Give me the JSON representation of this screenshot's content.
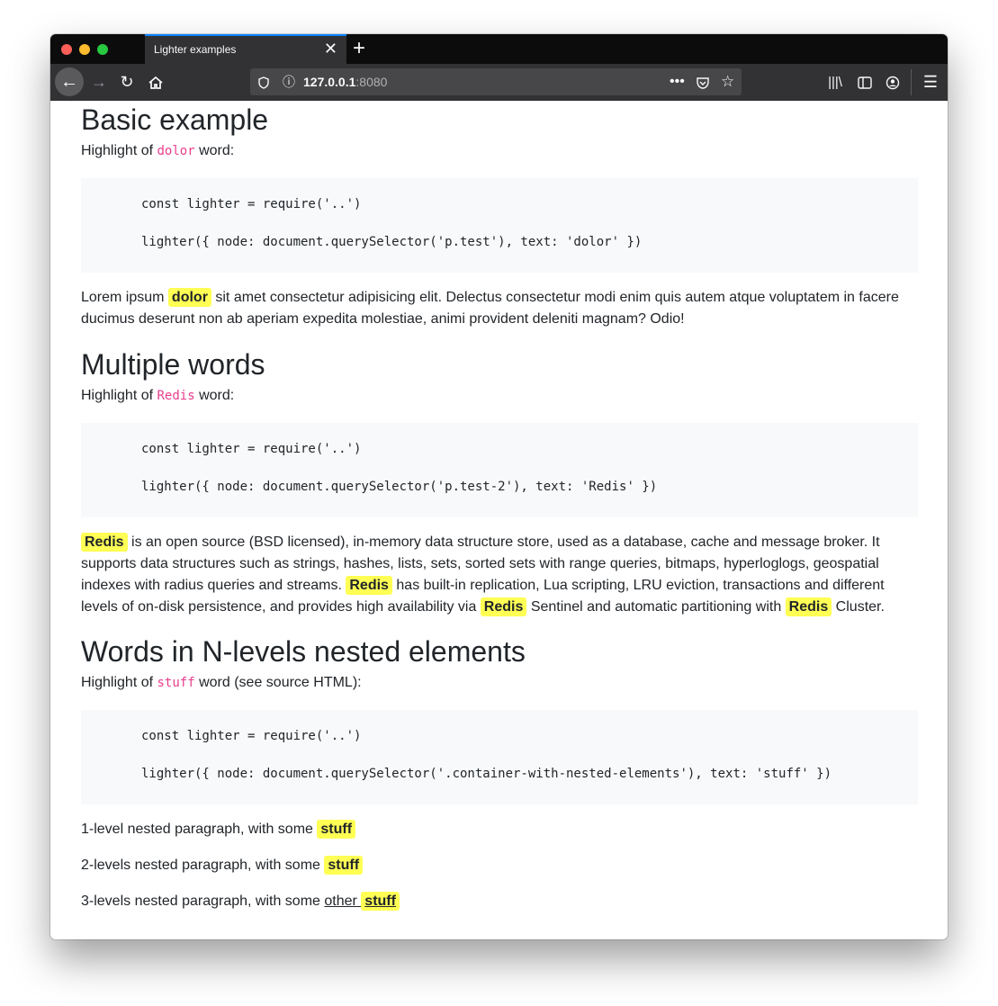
{
  "browser": {
    "tab_title": "Lighter examples",
    "url_host": "127.0.0.1",
    "url_port": ":8080"
  },
  "sections": [
    {
      "title": "Basic example",
      "intro_prefix": "Highlight of ",
      "intro_code": "dolor",
      "intro_suffix": " word:",
      "code_line1": "const lighter = require('..')",
      "code_line2": "lighter({ node: document.querySelector('p.test'), text: 'dolor' })",
      "text_before": "Lorem ipsum ",
      "highlight": "dolor",
      "text_after": " sit amet consectetur adipisicing elit. Delectus consectetur modi enim quis autem atque voluptatem in facere ducimus deserunt non ab aperiam expedita molestiae, animi provident deleniti magnam? Odio!"
    },
    {
      "title": "Multiple words",
      "intro_prefix": "Highlight of ",
      "intro_code": "Redis",
      "intro_suffix": " word:",
      "code_line1": "const lighter = require('..')",
      "code_line2": "lighter({ node: document.querySelector('p.test-2'), text: 'Redis' })",
      "highlight": "Redis",
      "text_part1": " is an open source (BSD licensed), in-memory data structure store, used as a database, cache and message broker. It supports data structures such as strings, hashes, lists, sets, sorted sets with range queries, bitmaps, hyperloglogs, geospatial indexes with radius queries and streams. ",
      "text_part2": " has built-in replication, Lua scripting, LRU eviction, transactions and different levels of on-disk persistence, and provides high availability via ",
      "text_part3": " Sentinel and automatic partitioning with ",
      "text_part4": " Cluster."
    },
    {
      "title": "Words in N-levels nested elements",
      "intro_prefix": "Highlight of ",
      "intro_code": "stuff",
      "intro_suffix": " word (see source HTML):",
      "code_line1": "const lighter = require('..')",
      "code_line2": "lighter({ node: document.querySelector('.container-with-nested-elements'), text: 'stuff' })",
      "highlight": "stuff",
      "line1": "1-level nested paragraph, with some ",
      "line2": "2-levels nested paragraph, with some ",
      "line3": "3-levels nested paragraph, with some ",
      "line3_link": "other "
    }
  ],
  "colors": {
    "highlight_bg": "#ffff54",
    "inline_code": "#e83e8c",
    "code_bg": "#f8f9fa",
    "tab_accent": "#0a84ff"
  }
}
